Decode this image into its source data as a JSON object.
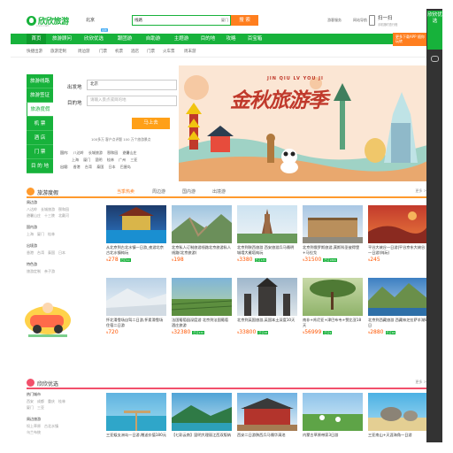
{
  "header": {
    "logo_text": "欣欣旅游",
    "logo_sub": "cncn.com",
    "city": "北京",
    "search_cat": "线路",
    "search_placeholder": "",
    "search_loc": "厦门",
    "search_btn": "搜 索",
    "links": [
      "游客服务",
      "网站导航",
      "我的"
    ],
    "qr_title": "扫一扫",
    "qr_sub": "手机随时查行程"
  },
  "nav": {
    "items": [
      "首页",
      "旅游顾问",
      "欣欣优选",
      "跟团游",
      "自助游",
      "主题游",
      "目的地",
      "攻略",
      "百宝箱"
    ],
    "badge": "最新",
    "app": "更多下载APP 随你玩转"
  },
  "subnav": [
    "快捷出游",
    "旅游定制",
    "周边游",
    "门票",
    "机票",
    "酒店",
    "门票",
    "火车票",
    "周末游"
  ],
  "search_panel": {
    "tabs": [
      "旅游线路",
      "旅游签证",
      "旅游度假",
      "机 票",
      "酒 店",
      "门 票",
      "目 的 地"
    ],
    "from_label": "出发地",
    "from_value": "北京",
    "to_label": "目的地",
    "to_placeholder": "请输入景点或目的地",
    "button": "马上去",
    "stat": "100多万 客户点评题  100 万个旅游景点",
    "dest_rows": [
      [
        "国内:",
        "八达岭",
        "长城旅游",
        "颐和园",
        "避暑山庄"
      ],
      [
        "",
        "上海",
        "厦门",
        "昆明",
        "桂林",
        "广州",
        "三亚"
      ],
      [
        "出境:",
        "香港",
        "台湾",
        "泰国",
        "日本",
        "巴厘岛"
      ]
    ]
  },
  "banner": {
    "pinyin": "JIN QIU LV YOU JI",
    "title": "金秋旅游季"
  },
  "section1": {
    "title": "旅游度假",
    "tabs": [
      "当季热卖",
      "周边游",
      "国内游",
      "出境游"
    ],
    "more": "更多 >",
    "filters": [
      {
        "title": "周边游",
        "items": [
          "八达岭",
          "长城旅游",
          "颐和园",
          "避暑山庄",
          "十三陵",
          "北戴河"
        ]
      },
      {
        "title": "国内游",
        "items": [
          "上海",
          "厦门",
          "桂林"
        ]
      },
      {
        "title": "出境游",
        "items": [
          "香港",
          "台湾",
          "泰国",
          "日本"
        ]
      },
      {
        "title": "特色游",
        "items": [
          "旅游定制",
          "亲子游"
        ]
      }
    ],
    "cards": [
      {
        "title": "从北京到古北水镇一日游_夜游北京古北水镇纯玩",
        "price": "278",
        "tag": "已订10"
      },
      {
        "title": "北京私人订制旅游线路北京旅游私人线路(北京旅游)",
        "price": "198",
        "tag": ""
      },
      {
        "title": "北京到陕西旅游 西安旅游兵马俑明城墙大雁塔纯玩",
        "price": "3380",
        "tag": "已订135"
      },
      {
        "title": "北京到俄罗斯旅游,莫斯科圣彼得堡+马拉戈",
        "price": "31500",
        "tag": "已订1869"
      },
      {
        "title": "平谷大峡谷一日游|平谷京东大峡谷一日游(纯玩)",
        "price": "245",
        "tag": ""
      },
      {
        "title": "怀北滑雪场自驾二日游,怀柔滑雪场住宿二日游",
        "price": "720",
        "tag": ""
      },
      {
        "title": "法国葡萄园深度游 北京到法国葡萄酒庄旅游",
        "price": "32380",
        "tag": "已订430"
      },
      {
        "title": "北京到英国旅游,英国本土深度10天",
        "price": "33800",
        "tag": "已订28"
      },
      {
        "title": "南非+肯尼亚+津巴布韦+赞比亚18天",
        "price": "56999",
        "tag": "已订9"
      },
      {
        "title": "北京到西藏旅游 西藏林芝拉萨羊湖8日",
        "price": "2880",
        "tag": "已订48"
      }
    ]
  },
  "section2": {
    "title": "欣欣优选",
    "more": "更多 >",
    "filters": [
      {
        "title": "热门城市",
        "items": [
          "西安",
          "成都",
          "重庆",
          "桂林",
          "厦门",
          "三亚"
        ]
      },
      {
        "title": "周边旅游",
        "items": [
          "坝上草原",
          "古北水镇",
          "乌兰布统"
        ]
      }
    ],
    "cards": [
      {
        "title": "三亚蜈支洲岛一日游,赠送价值180元"
      },
      {
        "title": "【七彩云南】昆明大理丽江西双版纳"
      },
      {
        "title": "西安二日游陕西兵马俑华清池"
      },
      {
        "title": "内蒙古草原带家3日游"
      },
      {
        "title": "三亚南山+天涯海角一日游"
      }
    ]
  },
  "float": {
    "top": "欣欣优选"
  }
}
